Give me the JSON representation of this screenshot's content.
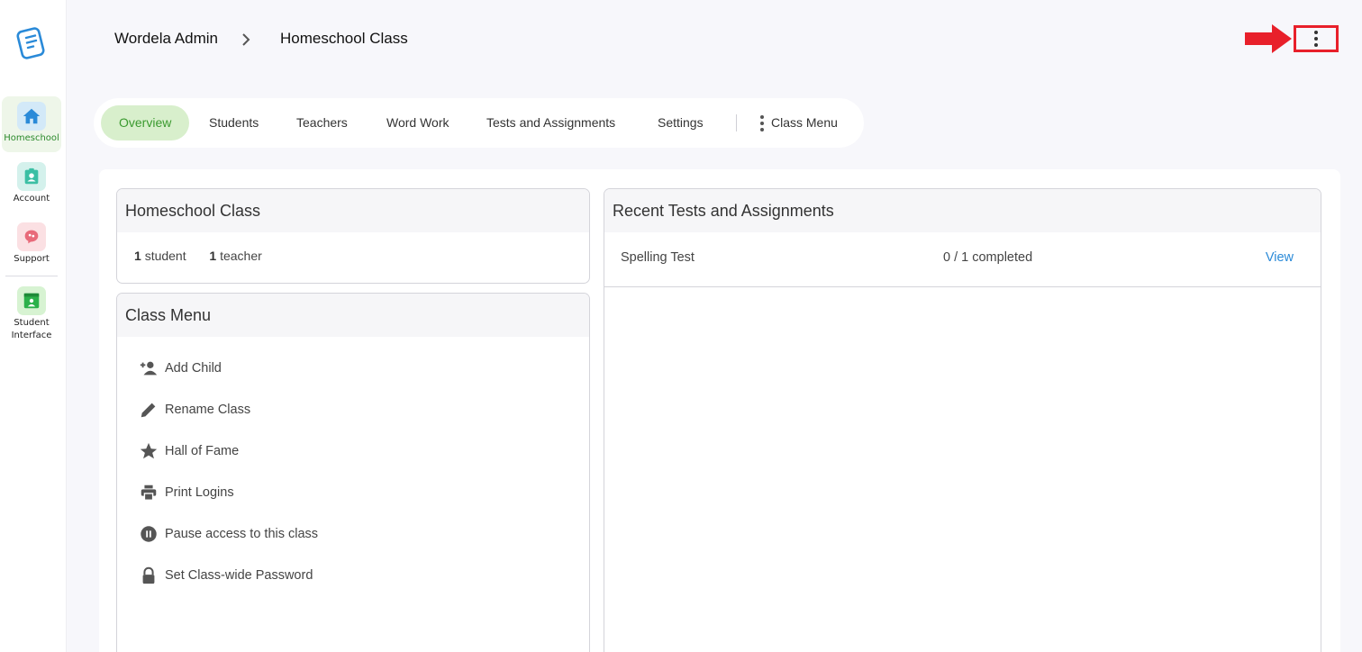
{
  "sidebar": {
    "items": [
      {
        "label": "Homeschool",
        "icon": "home-icon"
      },
      {
        "label": "Account",
        "icon": "account-badge-icon"
      },
      {
        "label": "Support",
        "icon": "support-brain-icon"
      },
      {
        "label": "Student Interface",
        "icon": "student-interface-icon"
      }
    ]
  },
  "header": {
    "breadcrumb": [
      "Wordela Admin",
      "Homeschool Class"
    ]
  },
  "tabs": [
    {
      "label": "Overview",
      "active": true
    },
    {
      "label": "Students"
    },
    {
      "label": "Teachers"
    },
    {
      "label": "Word Work"
    },
    {
      "label": "Tests and Assignments"
    },
    {
      "label": "Settings"
    },
    {
      "label": "Class Menu"
    }
  ],
  "class_card": {
    "title": "Homeschool Class",
    "student_count": "1",
    "student_label": "student",
    "teacher_count": "1",
    "teacher_label": "teacher"
  },
  "class_menu": {
    "title": "Class Menu",
    "items": [
      {
        "label": "Add Child",
        "icon": "add-person-icon"
      },
      {
        "label": "Rename Class",
        "icon": "pencil-icon"
      },
      {
        "label": "Hall of Fame",
        "icon": "star-icon"
      },
      {
        "label": "Print Logins",
        "icon": "printer-icon"
      },
      {
        "label": "Pause access to this class",
        "icon": "pause-icon"
      },
      {
        "label": "Set Class-wide Password",
        "icon": "lock-icon"
      }
    ]
  },
  "recent": {
    "title": "Recent Tests and Assignments",
    "rows": [
      {
        "name": "Spelling Test",
        "progress": "0 / 1 completed",
        "action": "View"
      }
    ]
  },
  "colors": {
    "accent_green": "#3a9a2f",
    "active_tab_bg": "#d8efcc",
    "link_blue": "#2a8ad8",
    "highlight_red": "#e8202a"
  }
}
